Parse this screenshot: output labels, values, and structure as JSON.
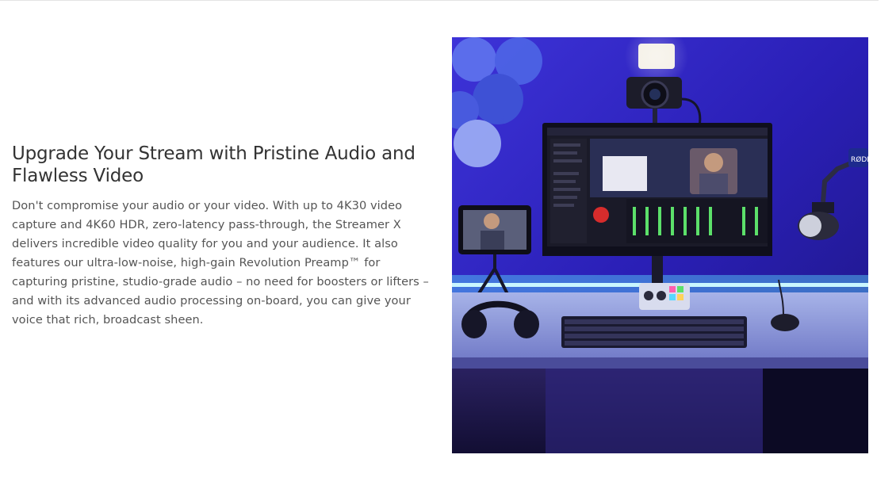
{
  "section": {
    "heading": "Upgrade Your Stream with Pristine Audio and Flawless Video",
    "body": "Don't compromise your audio or your video. With up to 4K30 video capture and 4K60 HDR, zero-latency pass-through, the Streamer X delivers incredible video quality for you and your audience. It also features our ultra-low-noise, high-gain Revolution Preamp™ for capturing pristine, studio-grade audio – no need for boosters or lifters – and with its advanced audio processing on-board, you can give your voice that rich, broadcast sheen."
  },
  "image": {
    "subject": "streaming desk setup with monitor, camera, light, microphone, Streamer X device, keyboard, mouse and headphones",
    "microphone_brand": "RØDE"
  },
  "colors": {
    "heading": "#333333",
    "body": "#555555",
    "background": "#ffffff",
    "scene_blue": "#2a1aa8",
    "led_cyan": "#6fe6ff"
  }
}
